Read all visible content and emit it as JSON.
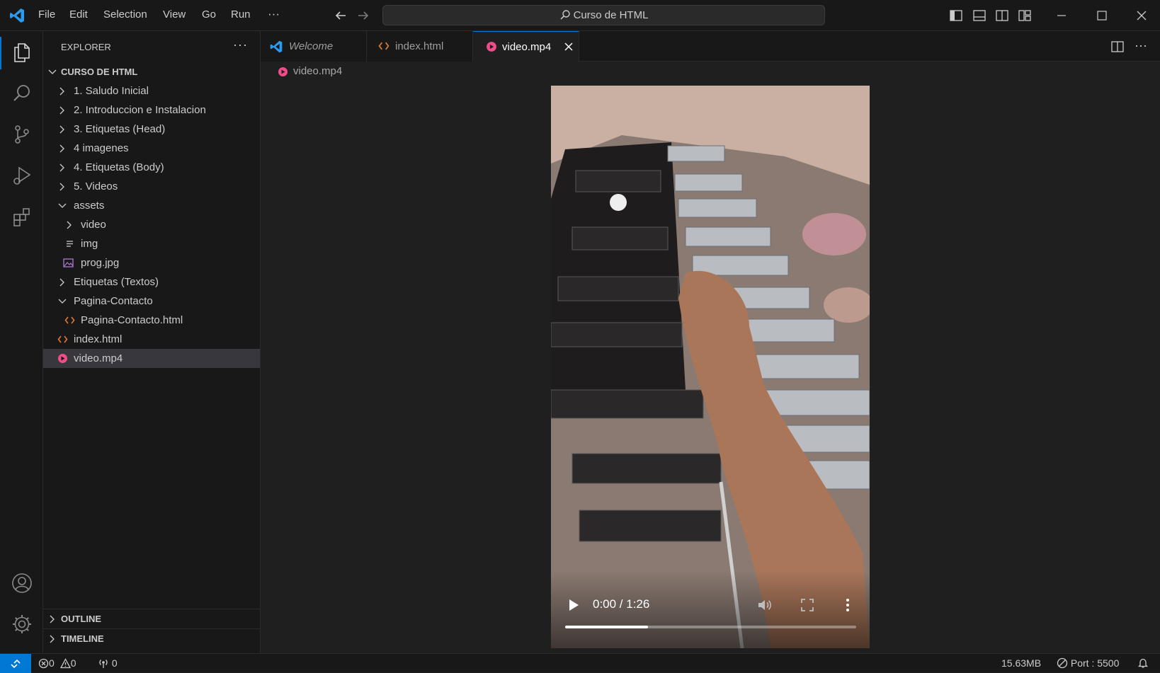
{
  "window": {
    "title": "Curso de HTML"
  },
  "menu": [
    "File",
    "Edit",
    "Selection",
    "View",
    "Go",
    "Run",
    "···"
  ],
  "sidebar": {
    "title": "EXPLORER",
    "more": "···",
    "root": "CURSO DE HTML",
    "items": [
      {
        "label": "1. Saludo Inicial"
      },
      {
        "label": "2. Introduccion e Instalacion"
      },
      {
        "label": "3. Etiquetas (Head)"
      },
      {
        "label": "4 imagenes"
      },
      {
        "label": "4. Etiquetas (Body)"
      },
      {
        "label": "5. Videos"
      },
      {
        "label": "assets"
      },
      {
        "label": "video"
      },
      {
        "label": "img"
      },
      {
        "label": "prog.jpg"
      },
      {
        "label": "Etiquetas (Textos)"
      },
      {
        "label": "Pagina-Contacto"
      },
      {
        "label": "Pagina-Contacto.html"
      },
      {
        "label": "index.html"
      },
      {
        "label": "video.mp4"
      }
    ],
    "outline": "OUTLINE",
    "timeline": "TIMELINE"
  },
  "tabs": [
    {
      "label": "Welcome"
    },
    {
      "label": "index.html"
    },
    {
      "label": "video.mp4"
    }
  ],
  "breadcrumb": "video.mp4",
  "video": {
    "time": "0:00 / 1:26",
    "progress": 0.285
  },
  "status": {
    "errors": "0",
    "warnings": "0",
    "ports": "0",
    "filesize": "15.63MB",
    "port": "Port : 5500"
  },
  "colors": {
    "accent": "#0078d4",
    "html_icon": "#e37933",
    "media_icon": "#f14c8a",
    "image_icon": "#a074c4"
  }
}
